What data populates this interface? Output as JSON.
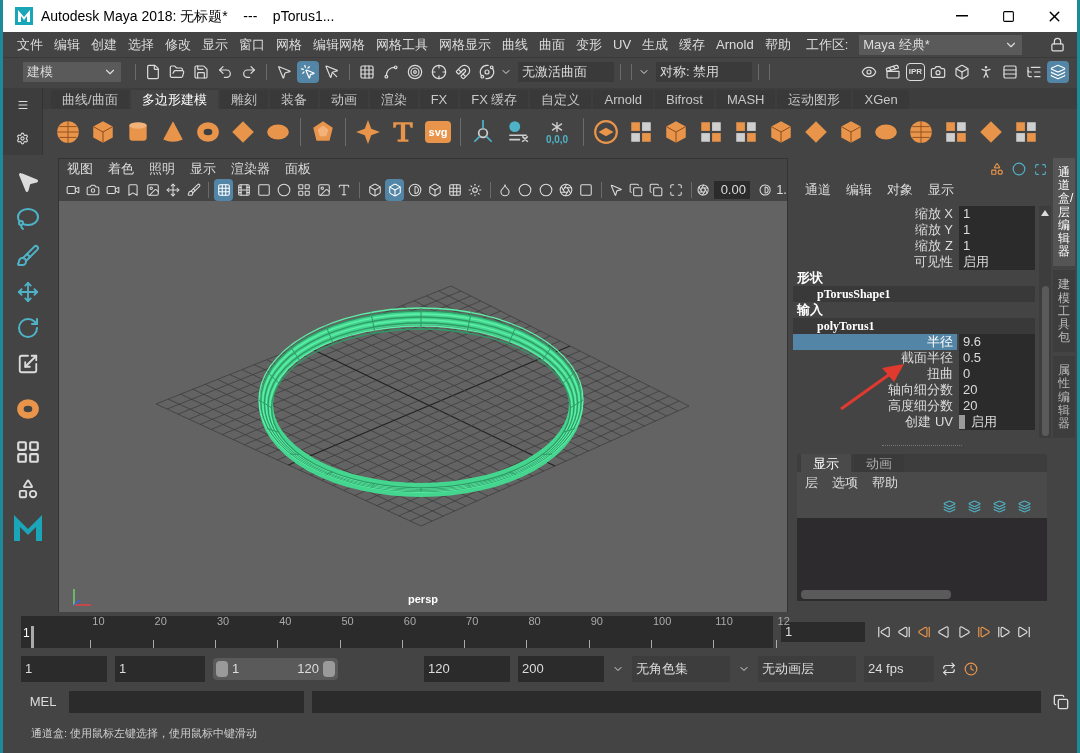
{
  "window": {
    "title": "Autodesk Maya 2018: 无标题*    ---    pTorus1..."
  },
  "menu_bar": {
    "items": [
      "文件",
      "编辑",
      "创建",
      "选择",
      "修改",
      "显示",
      "窗口",
      "网格",
      "编辑网格",
      "网格工具",
      "网格显示",
      "曲线",
      "曲面",
      "变形",
      "UV",
      "生成",
      "缓存",
      "Arnold",
      "帮助"
    ],
    "workspace_label": "工作区:",
    "workspace_value": "Maya 经典*"
  },
  "status_toolbar": {
    "mode": "建模",
    "buttons": [
      {
        "selected": false
      },
      {
        "selected": false
      },
      {
        "selected": false
      },
      {
        "selected": false
      },
      {
        "selected": false
      },
      {
        "selected": false
      },
      {
        "selected": true
      },
      {
        "selected": false
      },
      {
        "selected": false
      },
      {
        "selected": false
      },
      {
        "selected": false
      },
      {
        "selected": false
      },
      {
        "selected": false
      },
      {
        "selected": false
      }
    ],
    "live_surface": "无激活曲面",
    "symmetry": "对称: 禁用",
    "ipr_label": "IPR",
    "right_buttons": [
      {
        "selected": false
      },
      {
        "selected": false
      },
      {
        "selected": false
      },
      {
        "selected": false
      },
      {
        "selected": false
      },
      {
        "selected": false
      },
      {
        "selected": false
      },
      {
        "selected": false
      },
      {
        "selected": true
      }
    ]
  },
  "shelf": {
    "tabs": [
      {
        "label": "曲线/曲面",
        "selected": false
      },
      {
        "label": "多边形建模",
        "selected": true
      },
      {
        "label": "雕刻",
        "selected": false
      },
      {
        "label": "装备",
        "selected": false
      },
      {
        "label": "动画",
        "selected": false
      },
      {
        "label": "渲染",
        "selected": false
      },
      {
        "label": "FX",
        "selected": false
      },
      {
        "label": "FX 缓存",
        "selected": false
      },
      {
        "label": "自定义",
        "selected": false
      },
      {
        "label": "Arnold",
        "selected": false
      },
      {
        "label": "Bifrost",
        "selected": false
      },
      {
        "label": "MASH",
        "selected": false
      },
      {
        "label": "运动图形",
        "selected": false
      },
      {
        "label": "XGen",
        "selected": false
      }
    ],
    "svg_label": "svg",
    "freeze_label": "0,0,0"
  },
  "viewport_panel": {
    "menus": [
      "视图",
      "着色",
      "照明",
      "显示",
      "渲染器",
      "面板"
    ],
    "buttons": [
      {
        "selected": false
      },
      {
        "selected": false
      },
      {
        "selected": false
      },
      {
        "selected": false
      },
      {
        "selected": false
      },
      {
        "selected": false
      },
      {
        "selected": false
      },
      {
        "selected": true
      },
      {
        "selected": false
      },
      {
        "selected": false
      },
      {
        "selected": false
      },
      {
        "selected": false
      },
      {
        "selected": false
      },
      {
        "selected": false
      },
      {
        "selected": false
      },
      {
        "selected": true
      },
      {
        "selected": false
      },
      {
        "selected": false
      },
      {
        "selected": false
      },
      {
        "selected": false
      },
      {
        "selected": false
      },
      {
        "selected": false
      },
      {
        "selected": false
      },
      {
        "selected": false
      },
      {
        "selected": false
      },
      {
        "selected": false
      },
      {
        "selected": false
      },
      {
        "selected": false
      },
      {
        "selected": false
      }
    ],
    "exposure": "0.00",
    "gamma": "1.",
    "camera_label": "persp"
  },
  "channel_box": {
    "menus": [
      "通道",
      "编辑",
      "对象",
      "显示"
    ],
    "rows": [
      {
        "kind": "attr",
        "label": "缩放 X",
        "value": "1",
        "selected": false
      },
      {
        "kind": "attr",
        "label": "缩放 Y",
        "value": "1",
        "selected": false
      },
      {
        "kind": "attr",
        "label": "缩放 Z",
        "value": "1",
        "selected": false
      },
      {
        "kind": "attr",
        "label": "可见性",
        "value": "启用",
        "selected": false
      },
      {
        "kind": "section",
        "label": "形状"
      },
      {
        "kind": "node",
        "label": "pTorusShape1"
      },
      {
        "kind": "section",
        "label": "输入"
      },
      {
        "kind": "node",
        "label": "polyTorus1"
      },
      {
        "kind": "attr",
        "label": "半径",
        "value": "9.6",
        "selected": true
      },
      {
        "kind": "attr",
        "label": "截面半径",
        "value": "0.5",
        "selected": false
      },
      {
        "kind": "attr",
        "label": "扭曲",
        "value": "0",
        "selected": false
      },
      {
        "kind": "attr",
        "label": "轴向细分数",
        "value": "20",
        "selected": false
      },
      {
        "kind": "attr",
        "label": "高度细分数",
        "value": "20",
        "selected": false
      },
      {
        "kind": "toggle",
        "label": "创建 UV",
        "value": "启用",
        "selected": false
      }
    ]
  },
  "layer_editor": {
    "tabs": [
      {
        "label": "显示",
        "selected": true
      },
      {
        "label": "动画",
        "selected": false
      }
    ],
    "menus": [
      "层",
      "选项",
      "帮助"
    ]
  },
  "side_tabs": [
    {
      "label": "通道盒/层编辑器",
      "selected": true
    },
    {
      "label": "建模工具包",
      "selected": false
    },
    {
      "label": "属性编辑器",
      "selected": false
    }
  ],
  "timeline": {
    "level": 0,
    "start_label": "1",
    "ticks": [
      "10",
      "20",
      "30",
      "40",
      "50",
      "60",
      "70",
      "80",
      "90",
      "100",
      "110",
      "12"
    ],
    "current_frame": "1"
  },
  "range_bar": {
    "level": 1,
    "start": "1",
    "playback_start": "1",
    "slider_start": "1",
    "slider_end": "120",
    "playback_end": "120",
    "end": "200",
    "character_set": "无角色集",
    "anim_layer": "无动画层",
    "fps": "24 fps"
  },
  "command_line": {
    "label": "MEL"
  },
  "help_line": "通道盒: 使用鼠标左键选择，使用鼠标中键滑动"
}
